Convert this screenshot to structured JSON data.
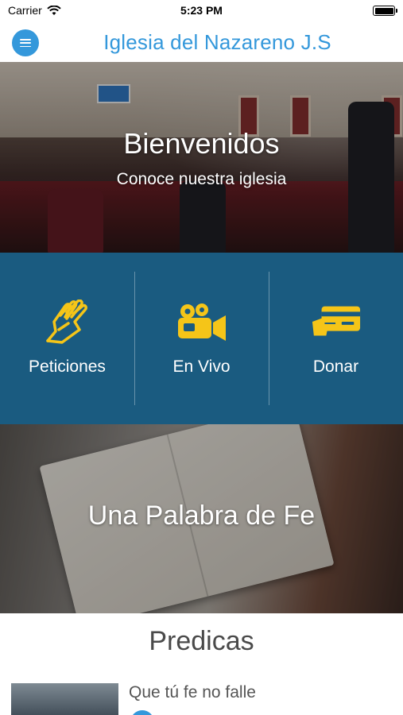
{
  "status_bar": {
    "carrier": "Carrier",
    "time": "5:23 PM"
  },
  "header": {
    "title": "Iglesia del Nazareno J.S",
    "menu_icon": "hamburger-menu-icon",
    "accent_color": "#3498db"
  },
  "hero": {
    "title": "Bienvenidos",
    "subtitle": "Conoce nuestra iglesia"
  },
  "actions": {
    "background_color": "#1a5b80",
    "icon_color": "#f5c518",
    "items": [
      {
        "label": "Peticiones",
        "icon": "praying-hands-icon"
      },
      {
        "label": "En Vivo",
        "icon": "video-camera-icon"
      },
      {
        "label": "Donar",
        "icon": "credit-card-icon"
      }
    ]
  },
  "bible_banner": {
    "title": "Una Palabra de Fe"
  },
  "predicas": {
    "heading": "Predicas",
    "items": [
      {
        "title": "Que tú fe no falle"
      }
    ]
  }
}
